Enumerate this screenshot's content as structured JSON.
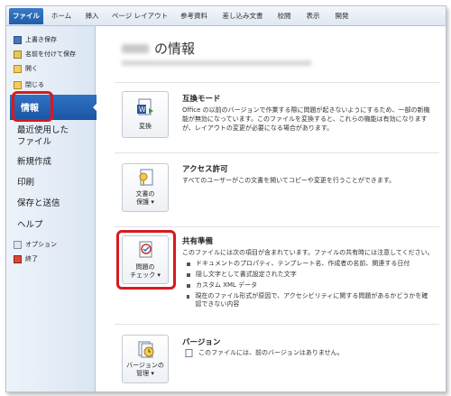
{
  "ribbon": {
    "tabs": [
      "ファイル",
      "ホーム",
      "挿入",
      "ページ レイアウト",
      "参考資料",
      "差し込み文書",
      "校閲",
      "表示",
      "開発"
    ]
  },
  "sidebar": {
    "small_items": [
      {
        "label": "上書き保存",
        "icon": "save-icon"
      },
      {
        "label": "名前を付けて保存",
        "icon": "save-as-icon"
      },
      {
        "label": "開く",
        "icon": "folder-open-icon"
      },
      {
        "label": "閉じる",
        "icon": "folder-close-icon"
      }
    ],
    "selected": "情報",
    "items": [
      "最近使用した\nファイル",
      "新規作成",
      "印刷",
      "保存と送信",
      "ヘルプ"
    ],
    "bottom_items": [
      {
        "label": "オプション",
        "icon": "options-icon"
      },
      {
        "label": "終了",
        "icon": "exit-icon"
      }
    ]
  },
  "main": {
    "title_suffix": "の情報",
    "sections": [
      {
        "button_label": "変換",
        "icon": "convert-document-icon",
        "title": "互換モード",
        "text": "Office の以前のバージョンで作業する際に問題が起きないようにするため、一部の新機能が無効になっています。このファイルを変換すると、これらの機能は有効になりますが、レイアウトの変更が必要になる場合があります。"
      },
      {
        "button_label_1": "文書の",
        "button_label_2": "保護",
        "icon": "protect-document-icon",
        "title": "アクセス許可",
        "text": "すべてのユーザーがこの文書を開いてコピーや変更を行うことができます。"
      },
      {
        "button_label_1": "問題の",
        "button_label_2": "チェック",
        "icon": "check-issues-icon",
        "title": "共有準備",
        "text": "このファイルには次の項目が含まれています。ファイルの共有時には注意してください。",
        "bullets": [
          "ドキュメントのプロパティ、テンプレート名、作成者の名前、関連する日付",
          "隠し文字として書式設定された文字",
          "カスタム XML データ",
          "現在のファイル形式が原因で、アクセシビリティに関する問題があるかどうかを確認できない内容"
        ]
      },
      {
        "button_label_1": "バージョンの",
        "button_label_2": "管理",
        "icon": "manage-versions-icon",
        "title": "バージョン",
        "text": "このファイルには、前のバージョンはありません。"
      }
    ]
  },
  "colors": {
    "selection": "#1b55a3",
    "highlight": "#d8191f"
  }
}
